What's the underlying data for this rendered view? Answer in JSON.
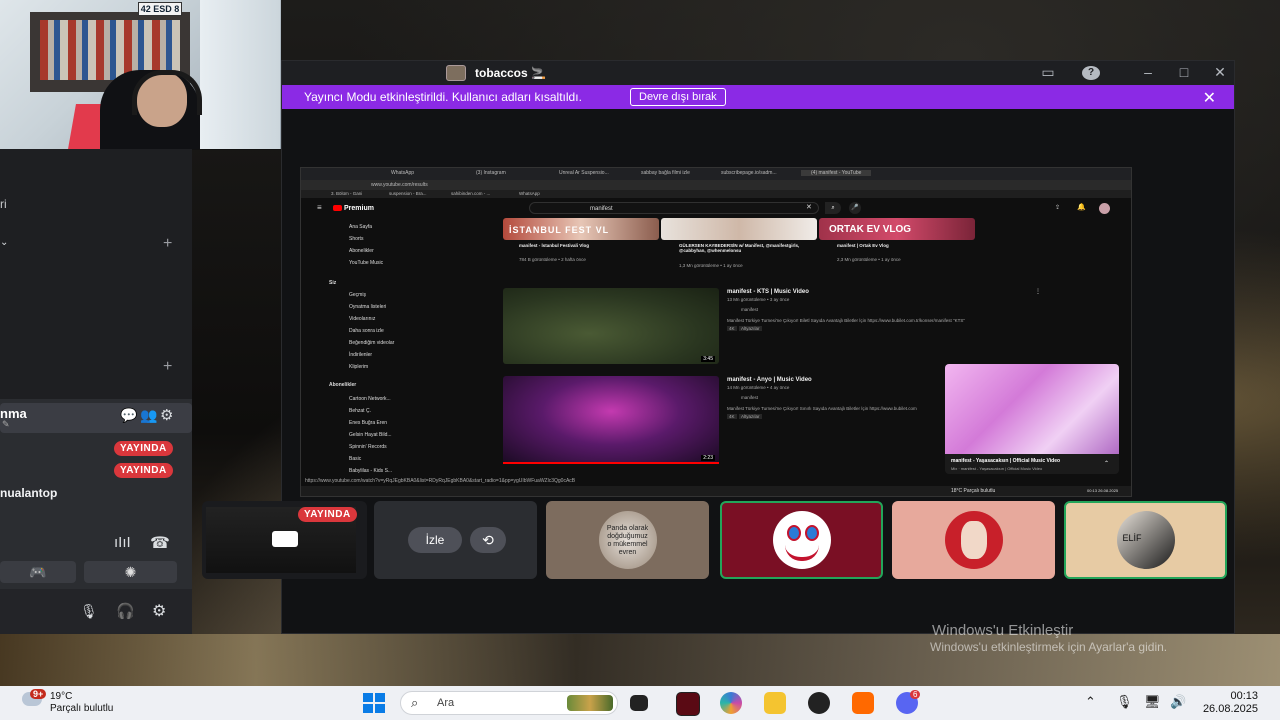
{
  "webcam": {
    "plate_text": "42 ESD 8"
  },
  "sidebar": {
    "top_text": "ri",
    "voice_user_name": "nma",
    "live_badge_1": "YAYINDA",
    "live_badge_2": "YAYINDA",
    "user_name": "nualantop"
  },
  "window": {
    "title": "tobaccos 🚬",
    "streamer_mode_text": "Yayıncı Modu etkinleştirildi. Kullanıcı adları kısaltıldı.",
    "disable_button": "Devre dışı bırak"
  },
  "stream": {
    "tabs": [
      "WhatsApp",
      "(3) Instagram",
      "Unreal Ar Suspensio...",
      "sabbay bağla filmi izle",
      "subscribepage.io/sadm...",
      "(4) manifest - YouTube"
    ],
    "address": "www.youtube.com/results",
    "bookmarks": [
      "3. Bölüm - Gani",
      "suspension - Bra...",
      "sahibinden.com - ...",
      "WhatsApp"
    ],
    "logo": "Premium",
    "search_query": "manifest",
    "sidebar_items": [
      "Ana Sayfa",
      "Shorts",
      "Abonelikler",
      "YouTube Music",
      "Siz",
      "Geçmiş",
      "Oynatma listeleri",
      "Videolarınız",
      "Daha sonra izle",
      "Beğendiğim videolar",
      "İndirilenler",
      "Kliplerim",
      "Abonelikler",
      "Cartoon Network...",
      "Behzat Ç.",
      "Enes Buğra Eren",
      "Gelsin Hayat Bild...",
      "Spinnin' Records",
      "Basic",
      "Babylilas - Kids S..."
    ],
    "top_videos": [
      {
        "thumb_text": "İSTANBUL FEST VL",
        "title": "manifest - İstanbul Festivali Vlog",
        "meta": "784 B görüntüleme • 2 hafta önce"
      },
      {
        "thumb_text": "",
        "title": "GÜLERSEN KAYBEDERSİN w/ Manifest, @manifestgirls, @cabbyhan, @whenmelonsu",
        "meta": "1,3 Mn görüntüleme • 1 ay önce"
      },
      {
        "thumb_text": "ORTAK EV VLOG",
        "title": "manifest | Ortak Ev Vlog",
        "meta": "2,3 Mn görüntüleme • 1 ay önce"
      }
    ],
    "results": [
      {
        "title": "manifest - KTS | Music Video",
        "meta": "13 Mn görüntüleme • 3 ay önce",
        "channel": "manifest",
        "desc": "Manifest Türkiye Turnesi'ne Çıkıyor! Biletl Sayıda Avantajlı Biletler İçin https://www.bubilet.com.tr/konser/manifest \"KTS\"",
        "badges": [
          "4K",
          "Altyazılar"
        ],
        "duration": "3:45"
      },
      {
        "title": "manifest - Anyo | Music Video",
        "meta": "14 Mn görüntüleme • 4 ay önce",
        "channel": "manifest",
        "desc": "Manifest Türkiye Turnesi'ne Çıkıyor! Sınırlı Sayıda Avantajlı Biletler İçin https://www.bubilet.com",
        "badges": [
          "4K",
          "Altyazılar"
        ],
        "duration": "2:23"
      }
    ],
    "mini_player": {
      "title": "manifest - Yaşasacaksın | Official Music Video",
      "sub": "Mix · manifest - Yaşasacaksın | Official Music Video"
    },
    "status_url": "https://www.youtube.com/watch?v=yRqJEgbKBA0&list=RDyRqJEgbKBA0&start_radio=1&pp=ygUIbWFuaWZlc3Qg0cAcB",
    "inner_weather": "18°C  Parçalı bulutlu",
    "inner_clock": "00:13 26.08.2025"
  },
  "tiles": [
    {
      "type": "stream",
      "badge": "YAYINDA"
    },
    {
      "type": "watch",
      "watch_label": "İzle"
    },
    {
      "type": "avatar",
      "avatar_text": "Panda olarak doğduğumuz o mükemmel evren"
    },
    {
      "type": "avatar",
      "speaking": true
    },
    {
      "type": "avatar"
    },
    {
      "type": "avatar",
      "speaking": true,
      "avatar_text": "ELİF"
    }
  ],
  "watermark": {
    "title": "Windows'u Etkinleştir",
    "subtitle": "Windows'u etkinleştirmek için Ayarlar'a gidin."
  },
  "taskbar": {
    "weather_badge": "9+",
    "temperature": "19°C",
    "weather_desc": "Parçalı bulutlu",
    "search_placeholder": "Ara",
    "discord_badge": "6",
    "time": "00:13",
    "date": "26.08.2025"
  },
  "colors": {
    "streamer_bar": "#8b2ae5",
    "live_red": "#da373c",
    "speaking_green": "#23a55a"
  }
}
